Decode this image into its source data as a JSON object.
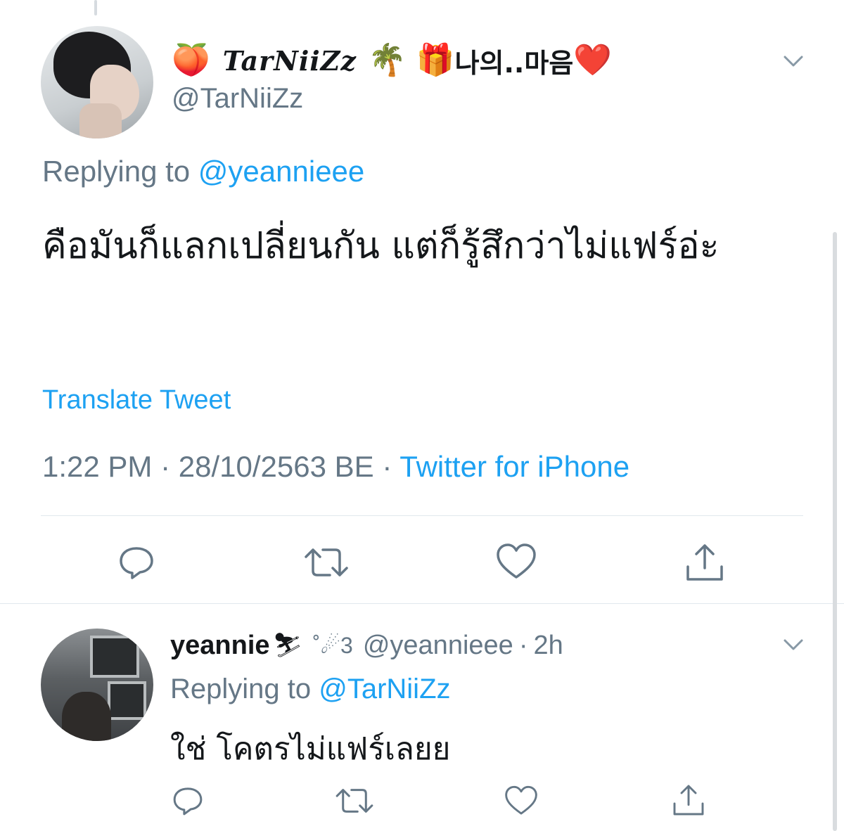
{
  "main_tweet": {
    "display_name_prefix_emoji": "🍑",
    "display_name": "TarNiiZz",
    "display_name_suffix_emoji": "🌴 🎁",
    "display_name_korean": "나의..마음",
    "display_name_heart": "❤️",
    "handle": "@TarNiiZz",
    "replying_prefix": "Replying to ",
    "replying_to": "@yeannieee",
    "text": "คือมันก็แลกเปลี่ยนกัน แต่ก็รู้สึกว่าไม่แฟร์อ่ะ",
    "translate_label": "Translate Tweet",
    "time": "1:22 PM",
    "date": "28/10/2563 BE",
    "separator": "·",
    "source": "Twitter for iPhone"
  },
  "reply_tweet": {
    "display_name": "yeannie",
    "name_emoji": "⛷",
    "name_deco": "˚☄︎3",
    "handle": "@yeannieee",
    "separator": "·",
    "age": "2h",
    "replying_prefix": "Replying to ",
    "replying_to": "@TarNiiZz",
    "text": "ใช่ โคตรไม่แฟร์เลยย"
  },
  "colors": {
    "primary_text": "#14171a",
    "secondary_text": "#657786",
    "accent": "#1da1f2",
    "divider": "#e1e8ed"
  },
  "icons": [
    "chevron-down-icon",
    "reply-icon",
    "retweet-icon",
    "like-icon",
    "share-icon"
  ]
}
